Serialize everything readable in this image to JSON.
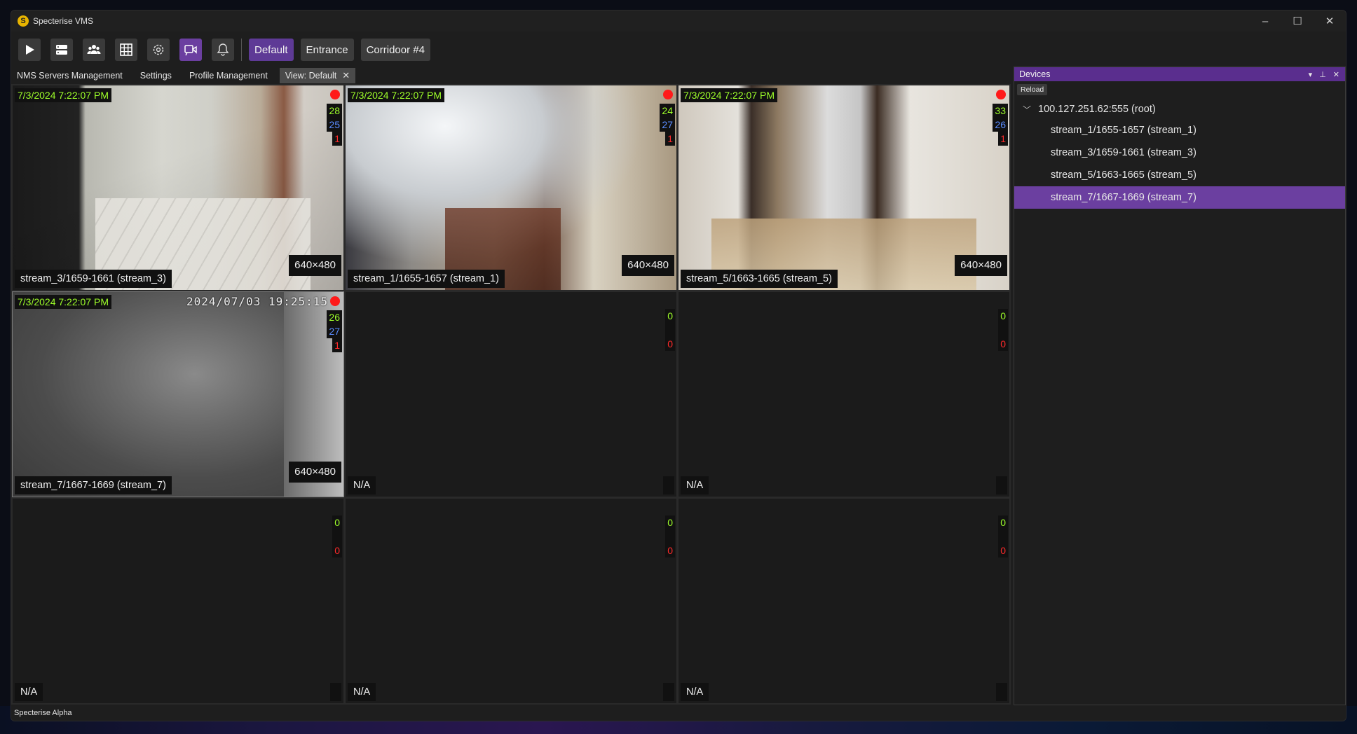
{
  "window": {
    "title": "Specterise VMS",
    "logo_glyph": "S"
  },
  "window_controls": {
    "minimize": "–",
    "maximize": "☐",
    "close": "✕"
  },
  "toolbar": {
    "icons": [
      "play-icon",
      "server-icon",
      "users-icon",
      "grid-settings-icon",
      "gear-icon",
      "camera-icon",
      "bell-icon"
    ],
    "views": [
      {
        "label": "Default",
        "active": true
      },
      {
        "label": "Entrance",
        "active": false
      },
      {
        "label": "Corridoor #4",
        "active": false
      }
    ]
  },
  "tabs": [
    {
      "label": "NMS Servers Management"
    },
    {
      "label": "Settings"
    },
    {
      "label": "Profile Management"
    },
    {
      "label": "View: Default",
      "closable": true,
      "active": true
    }
  ],
  "tab_close_glyph": "✕",
  "grid": {
    "cells": [
      {
        "timestamp": "7/3/2024 7:22:07 PM",
        "recording": true,
        "stats": [
          "28",
          "25",
          "1"
        ],
        "label": "stream_3/1659-1661 (stream_3)",
        "resolution": "640×480"
      },
      {
        "timestamp": "7/3/2024 7:22:07 PM",
        "recording": true,
        "stats": [
          "24",
          "27",
          "1"
        ],
        "label": "stream_1/1655-1657 (stream_1)",
        "resolution": "640×480"
      },
      {
        "timestamp": "7/3/2024 7:22:07 PM",
        "recording": true,
        "stats": [
          "33",
          "26",
          "1"
        ],
        "label": "stream_5/1663-1665 (stream_5)",
        "resolution": "640×480"
      },
      {
        "timestamp": "7/3/2024 7:22:07 PM",
        "recording": true,
        "osd": "2024/07/03 19:25:15",
        "stats": [
          "26",
          "27",
          "1"
        ],
        "label": "stream_7/1667-1669 (stream_7)",
        "resolution": "640×480"
      },
      {
        "stats": [
          "0",
          "",
          "0"
        ],
        "label": "N/A"
      },
      {
        "stats": [
          "0",
          "",
          "0"
        ],
        "label": "N/A"
      },
      {
        "stats": [
          "0",
          "",
          "0"
        ],
        "label": "N/A"
      },
      {
        "stats": [
          "0",
          "",
          "0"
        ],
        "label": "N/A"
      },
      {
        "stats": [
          "0",
          "",
          "0"
        ],
        "label": "N/A"
      }
    ]
  },
  "devices": {
    "title": "Devices",
    "header_controls": [
      "▾",
      "⊥",
      "✕"
    ],
    "reload_label": "Reload",
    "root": "100.127.251.62:555 (root)",
    "root_chevron": "﹀",
    "streams": [
      {
        "label": "stream_1/1655-1657 (stream_1)",
        "selected": false
      },
      {
        "label": "stream_3/1659-1661 (stream_3)",
        "selected": false
      },
      {
        "label": "stream_5/1663-1665 (stream_5)",
        "selected": false
      },
      {
        "label": "stream_7/1667-1669 (stream_7)",
        "selected": true
      }
    ]
  },
  "statusbar": {
    "text": "Specterise Alpha"
  },
  "colors": {
    "accent": "#6b3fa0",
    "panel_header": "#5a2e8e",
    "timestamp_green": "#9eff2a",
    "stat_blue": "#5a8cff",
    "stat_red": "#ff2a2a",
    "record_red": "#ff1a1a"
  }
}
